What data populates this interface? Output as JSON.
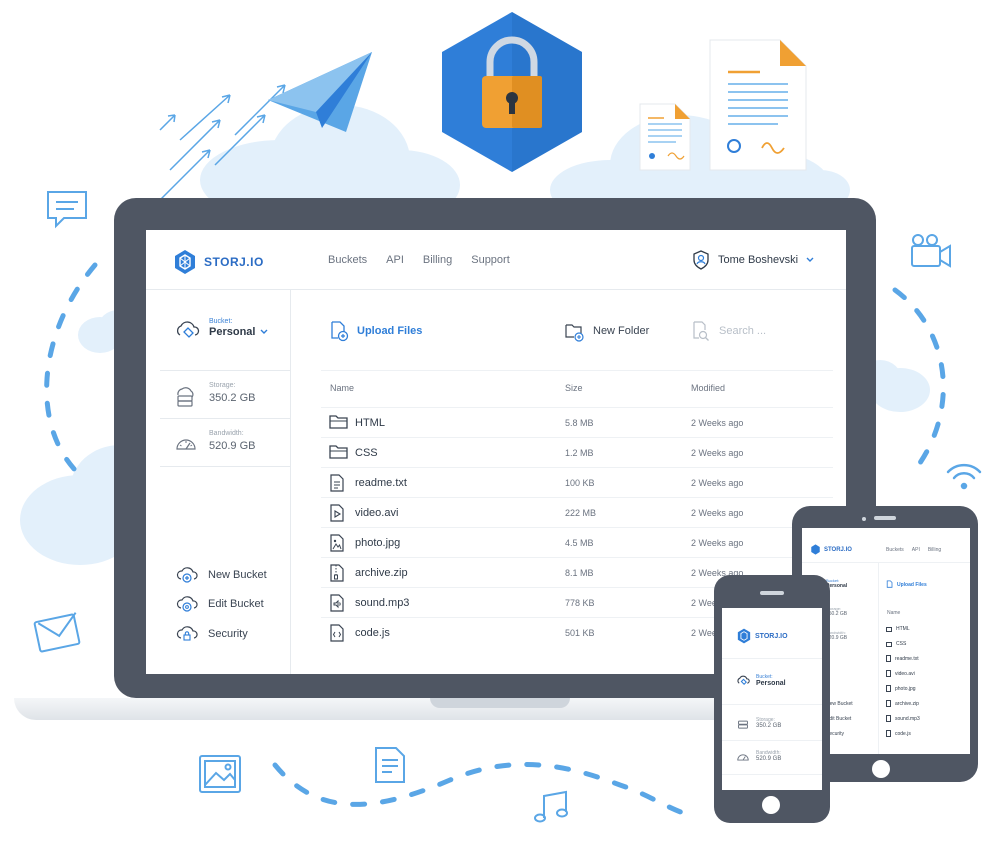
{
  "brand": {
    "name": "STORJ.IO"
  },
  "nav": {
    "items": [
      "Buckets",
      "API",
      "Billing",
      "Support"
    ]
  },
  "user": {
    "name": "Tome Boshevski"
  },
  "sidebar": {
    "bucket_label": "Bucket:",
    "bucket_value": "Personal",
    "storage_label": "Storage:",
    "storage_value": "350.2 GB",
    "bandwidth_label": "Bandwidth:",
    "bandwidth_value": "520.9 GB",
    "actions": [
      "New Bucket",
      "Edit Bucket",
      "Security"
    ]
  },
  "toolbar": {
    "upload_label": "Upload Files",
    "new_folder_label": "New Folder",
    "search_placeholder": "Search ..."
  },
  "table": {
    "columns": [
      "Name",
      "Size",
      "Modified"
    ],
    "rows": [
      {
        "name": "HTML",
        "size": "5.8 MB",
        "modified": "2 Weeks ago",
        "icon": "folder-icon"
      },
      {
        "name": "CSS",
        "size": "1.2 MB",
        "modified": "2 Weeks ago",
        "icon": "folder-icon"
      },
      {
        "name": "readme.txt",
        "size": "100 KB",
        "modified": "2 Weeks ago",
        "icon": "text-file-icon"
      },
      {
        "name": "video.avi",
        "size": "222 MB",
        "modified": "2 Weeks ago",
        "icon": "video-file-icon"
      },
      {
        "name": "photo.jpg",
        "size": "4.5 MB",
        "modified": "2 Weeks ago",
        "icon": "image-file-icon"
      },
      {
        "name": "archive.zip",
        "size": "8.1 MB",
        "modified": "2 Weeks ago",
        "icon": "archive-file-icon"
      },
      {
        "name": "sound.mp3",
        "size": "778 KB",
        "modified": "2 Wee",
        "icon": "audio-file-icon"
      },
      {
        "name": "code.js",
        "size": "501 KB",
        "modified": "2 Wee",
        "icon": "code-file-icon"
      }
    ]
  },
  "tablet": {
    "brand": "STORJ.IO",
    "nav": [
      "Buckets",
      "API",
      "Billing"
    ],
    "bucket_label": "Bucket:",
    "bucket_value": "Personal",
    "storage_label": "Storage:",
    "storage_value": "350.2 GB",
    "bandwidth_label": "Bandwidth:",
    "bandwidth_value": "520.9 GB",
    "upload_label": "Upload Files",
    "name_col": "Name",
    "actions": [
      "New Bucket",
      "Edit Bucket",
      "Security"
    ],
    "files": [
      "HTML",
      "CSS",
      "readme.txt",
      "video.avi",
      "photo.jpg",
      "archive.zip",
      "sound.mp3",
      "code.js"
    ]
  },
  "phone": {
    "brand": "STORJ.IO",
    "bucket_label": "Bucket:",
    "bucket_value": "Personal",
    "storage_label": "Storage:",
    "storage_value": "350.2 GB",
    "bandwidth_label": "Bandwidth:",
    "bandwidth_value": "520.9 GB"
  },
  "colors": {
    "accent": "#2f7ed8",
    "device_frame": "#4f5663",
    "illustration_blue": "#5aa6e6",
    "cloud": "#e3f0fb",
    "lock_body": "#f0a033"
  }
}
